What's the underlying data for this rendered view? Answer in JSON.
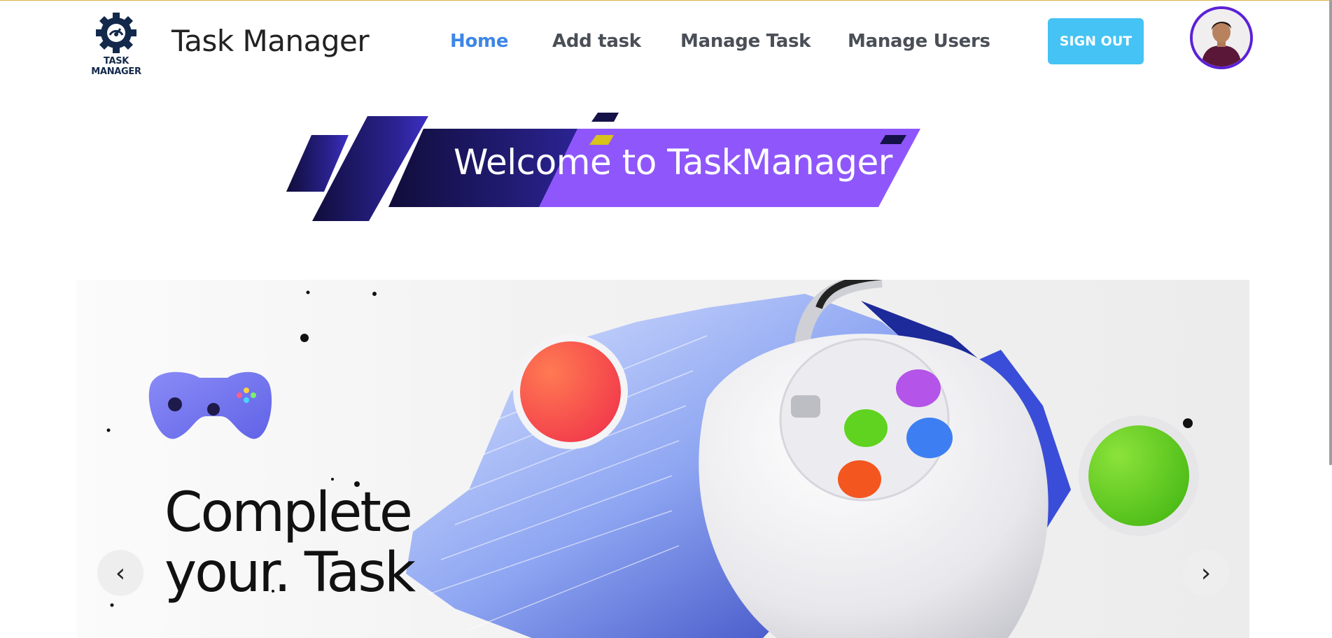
{
  "header": {
    "logo_text": "TASK MANAGER",
    "brand": "Task Manager",
    "nav": [
      {
        "label": "Home",
        "active": true
      },
      {
        "label": "Add task",
        "active": false
      },
      {
        "label": "Manage Task",
        "active": false
      },
      {
        "label": "Manage Users",
        "active": false
      }
    ],
    "signout_label": "SIGN OUT",
    "avatar_icon": "user-avatar"
  },
  "banner": {
    "title": "Welcome to TaskManager"
  },
  "carousel": {
    "heading": "Complete\nyour. Task",
    "prev_label": "‹",
    "next_label": "›"
  },
  "colors": {
    "nav_active": "#3d86e6",
    "nav": "#4a4f57",
    "signout_bg": "#45c3f4",
    "banner_dark": "#15124a",
    "banner_purple": "#8f57fb",
    "avatar_border": "#5b21d6"
  }
}
